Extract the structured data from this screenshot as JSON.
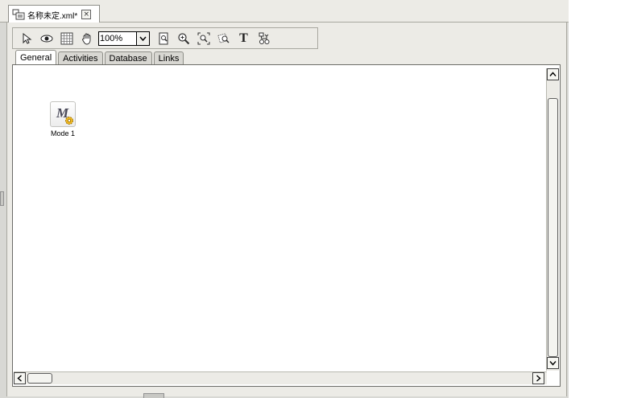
{
  "document": {
    "tab_title": "名称未定.xml*",
    "close_symbol": "×"
  },
  "toolbar": {
    "zoom_value": "100%",
    "text_tool_label": "T",
    "icons": [
      "select-arrow-icon",
      "eye-icon",
      "grid-icon",
      "hand-pan-icon",
      "zoom-dropdown-arrow-icon",
      "fit-page-icon",
      "zoom-in-icon",
      "zoom-region-icon",
      "zoom-out-icon",
      "text-tool-icon",
      "layout-tool-icon"
    ]
  },
  "tabs": [
    {
      "label": "General",
      "active": true
    },
    {
      "label": "Activities",
      "active": false
    },
    {
      "label": "Database",
      "active": false
    },
    {
      "label": "Links",
      "active": false
    }
  ],
  "canvas": {
    "nodes": [
      {
        "label": "Mode 1",
        "icon_letter": "M",
        "icon": "mode-gear-icon"
      }
    ]
  },
  "colors": {
    "chrome_bg": "#ecebe6",
    "canvas_bg": "#ffffff",
    "border": "#6c6c68"
  }
}
